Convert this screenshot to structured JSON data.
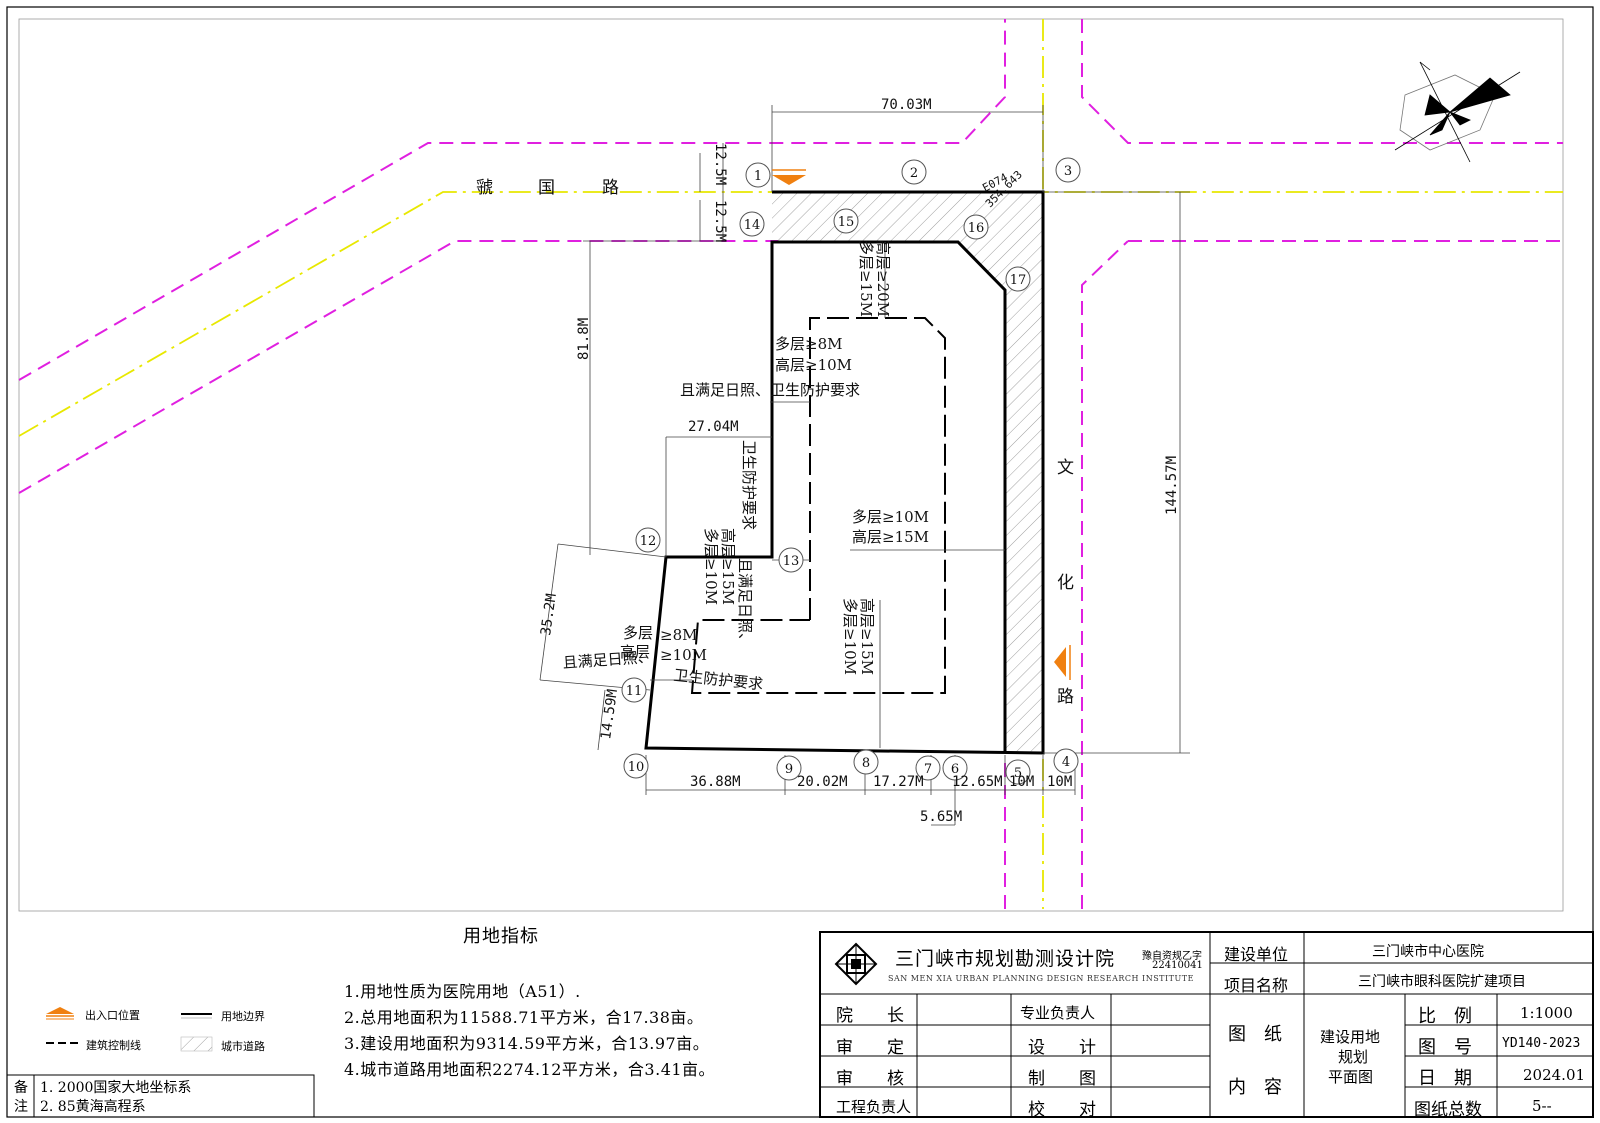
{
  "road_names": {
    "horizontal": [
      "虢",
      "国",
      "路"
    ],
    "vertical": [
      "文",
      "化",
      "路"
    ]
  },
  "point_labels": [
    "1",
    "2",
    "3",
    "4",
    "5",
    "6",
    "7",
    "8",
    "9",
    "10",
    "11",
    "12",
    "13",
    "14",
    "15",
    "16",
    "17"
  ],
  "dimensions": {
    "top_width": "70.03M",
    "road_half_upper": "12.5M",
    "road_half_lower": "12.5M",
    "left_height": "81.8M",
    "right_height": "144.57M",
    "notch_width": "27.04M",
    "lower_left_height": "35.2M",
    "bottom_left_height": "14.59M",
    "bottom_seg_1": "36.88M",
    "bottom_seg_2": "20.02M",
    "bottom_seg_3": "17.27M",
    "bottom_seg_4": "12.65M",
    "bottom_seg_5": "10M",
    "bottom_seg_6": "10M",
    "bottom_seg_7": "5.65M",
    "survey_code": "E074",
    "survey_value": "354.643"
  },
  "setback_notes": {
    "top_rotated": [
      "多层≥15M",
      "高层≥20M"
    ],
    "center_upper": [
      "多层≥8M",
      "高层≥10M"
    ],
    "center_upper_req": "且满足日照、卫生防护要求",
    "left_rotated_req": "卫生防护要求",
    "right_mid": [
      "多层≥10M",
      "高层≥15M"
    ],
    "left_mid_rotated": [
      "多层≥10M",
      "高层≥15M",
      "且满足日照、"
    ],
    "bottom_rotated": [
      "多层≥10M",
      "高层≥15M"
    ],
    "lower_left": [
      "多层",
      "高层",
      "≥8M",
      "≥10M"
    ],
    "lower_left_req_a": "且满足日照、",
    "lower_left_req_b": "卫生防护要求"
  },
  "land_indicators": {
    "title": "用地指标",
    "items": [
      "1.用地性质为医院用地（A51）.",
      "2.总用地面积为11588.71平方米，合17.38亩。",
      "3.建设用地面积为9314.59平方米，合13.97亩。",
      "4.城市道路用地面积2274.12平方米，合3.41亩。"
    ]
  },
  "legend": {
    "entrance": "出入口位置",
    "boundary": "用地边界",
    "control_line": "建筑控制线",
    "city_road": "城市道路"
  },
  "notes": {
    "label_top": "备",
    "label_bottom": "注",
    "lines": [
      "1. 2000国家大地坐标系",
      "2. 85黄海高程系"
    ]
  },
  "title_block": {
    "institute_cn": "三门峡市规划勘测设计院",
    "institute_en": "SAN MEN XIA URBAN PLANNING DESIGN RESEARCH INSTITUTE",
    "license_a": "豫自资规乙字",
    "license_b": "22410041",
    "builder_label": "建设单位",
    "builder_value": "三门峡市中心医院",
    "project_label": "项目名称",
    "project_value": "三门峡市眼科医院扩建项目",
    "dean": "院　　长",
    "approve": "审　　定",
    "review": "审　　核",
    "engineer": "工程负责人",
    "specialist": "专业负责人",
    "design": "设　　计",
    "draw": "制　　图",
    "check": "校　　对",
    "drawing_content_a": "图　纸",
    "drawing_content_b": "内　容",
    "drawing_name": [
      "建设用地",
      "规划",
      "平面图"
    ],
    "scale_label": "比　例",
    "scale_value": "1:1000",
    "number_label": "图　号",
    "number_value": "YD140-2023",
    "date_label": "日　期",
    "date_value": "2024.01",
    "total_label": "图纸总数",
    "total_value": "5--"
  },
  "colors": {
    "road_red_line": "#e020e0",
    "road_center_line": "#e8e800",
    "entrance_marker": "#f08010",
    "boundary": "#000000"
  }
}
